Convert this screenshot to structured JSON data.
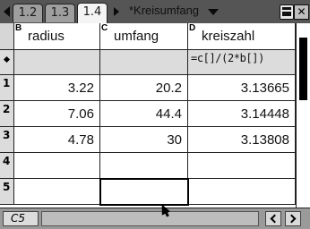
{
  "tabs": [
    "1.2",
    "1.3",
    "1.4"
  ],
  "active_tab": "1.4",
  "document_title": "*Kreisumfang",
  "columns": [
    {
      "letter": "B",
      "name": "radius"
    },
    {
      "letter": "C",
      "name": "umfang"
    },
    {
      "letter": "D",
      "name": "kreiszahl"
    }
  ],
  "formula_row": {
    "D": "=c[]/(2*b[])"
  },
  "row_numbers": [
    "1",
    "2",
    "3",
    "4",
    "5"
  ],
  "rows": [
    {
      "B": "3.22",
      "C": "20.2",
      "D": "3.13665"
    },
    {
      "B": "7.06",
      "C": "44.4",
      "D": "3.14448"
    },
    {
      "B": "4.78",
      "C": "30",
      "D": "3.13808"
    },
    {
      "B": "",
      "C": "",
      "D": ""
    },
    {
      "B": "",
      "C": "",
      "D": ""
    }
  ],
  "status_bar": {
    "cell_reference": "C5"
  }
}
